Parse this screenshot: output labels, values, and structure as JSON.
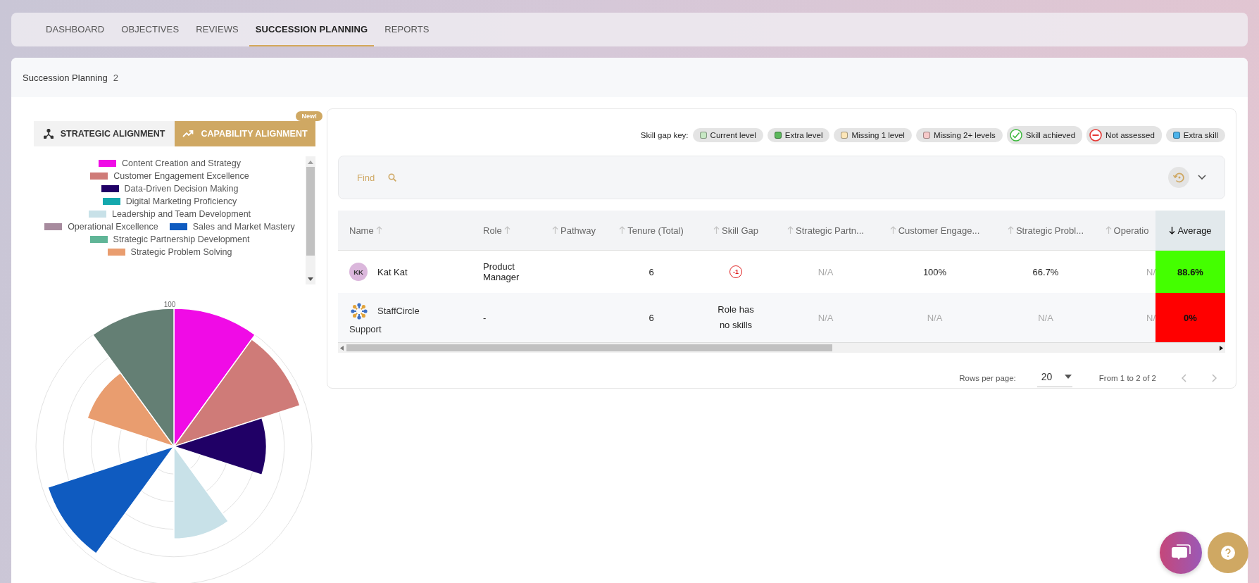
{
  "nav": {
    "tabs": [
      {
        "label": "DASHBOARD",
        "selected": false
      },
      {
        "label": "OBJECTIVES",
        "selected": false
      },
      {
        "label": "REVIEWS",
        "selected": false
      },
      {
        "label": "SUCCESSION PLANNING",
        "selected": true
      },
      {
        "label": "REPORTS",
        "selected": false
      }
    ]
  },
  "header": {
    "title": "Succession Planning",
    "count": "2"
  },
  "alignment": {
    "badge": "New!",
    "tabs": [
      {
        "label": "STRATEGIC ALIGNMENT",
        "selected": false
      },
      {
        "label": "CAPABILITY ALIGNMENT",
        "selected": true
      }
    ]
  },
  "legend": [
    {
      "label": "Content Creation and Strategy",
      "color": "#f00be6"
    },
    {
      "label": "Customer Engagement Excellence",
      "color": "#cf7b78"
    },
    {
      "label": "Data-Driven Decision Making",
      "color": "#200066"
    },
    {
      "label": "Digital Marketing Proficiency",
      "color": "#14a8ad"
    },
    {
      "label": "Leadership and Team Development",
      "color": "#c8e1e8"
    },
    {
      "label": "Operational Excellence",
      "color": "#a78b9e"
    },
    {
      "label": "Sales and Market Mastery",
      "color": "#0f5bc0"
    },
    {
      "label": "Strategic Partnership Development",
      "color": "#60b597"
    },
    {
      "label": "Strategic Problem Solving",
      "color": "#e99d6f"
    }
  ],
  "chart_tick": "100",
  "skill_gap_key": {
    "label": "Skill gap key:",
    "items": [
      {
        "label": "Current level",
        "kind": "swatch",
        "color": "#c7e8c4"
      },
      {
        "label": "Extra level",
        "kind": "swatch",
        "color": "#5cb85c"
      },
      {
        "label": "Missing 1 level",
        "kind": "swatch",
        "color": "#fde6b8"
      },
      {
        "label": "Missing 2+ levels",
        "kind": "swatch",
        "color": "#f6c9c9"
      },
      {
        "label": "Skill achieved",
        "kind": "check"
      },
      {
        "label": "Not assessed",
        "kind": "minus"
      },
      {
        "label": "Extra skill",
        "kind": "swatch",
        "color": "#4db3ea"
      }
    ]
  },
  "search": {
    "placeholder": "Find"
  },
  "table": {
    "columns": [
      {
        "label": "Name",
        "sorted": false
      },
      {
        "label": "Role",
        "sorted": false
      },
      {
        "label": "Pathway",
        "sorted": false
      },
      {
        "label": "Tenure (Total)",
        "sorted": false
      },
      {
        "label": "Skill Gap",
        "sorted": false
      },
      {
        "label": "Strategic Partn...",
        "sorted": false
      },
      {
        "label": "Customer Engage...",
        "sorted": false
      },
      {
        "label": "Strategic Probl...",
        "sorted": false
      },
      {
        "label": "Operatio",
        "sorted": false
      },
      {
        "label": "Average",
        "sorted": true
      }
    ],
    "rows": [
      {
        "name": "Kat Kat",
        "avatar": {
          "kind": "initials",
          "text": "KK"
        },
        "role": "Product Manager",
        "tenure": "6",
        "skill_gap": {
          "kind": "badge",
          "text": "-1"
        },
        "scores": [
          {
            "text": "N/A",
            "muted": true
          },
          {
            "text": "100%",
            "muted": false
          },
          {
            "text": "66.7%",
            "muted": false
          },
          {
            "text": "N/",
            "muted": true
          }
        ],
        "average": {
          "text": "88.6%",
          "color": "#44ff00"
        }
      },
      {
        "name": "StaffCircle Support",
        "avatar": {
          "kind": "logo"
        },
        "role": "-",
        "tenure": "6",
        "skill_gap": {
          "kind": "text",
          "text": "Role has no skills"
        },
        "scores": [
          {
            "text": "N/A",
            "muted": true
          },
          {
            "text": "N/A",
            "muted": true
          },
          {
            "text": "N/A",
            "muted": true
          },
          {
            "text": "N/",
            "muted": true
          }
        ],
        "average": {
          "text": "0%",
          "color": "#ff0000"
        }
      }
    ]
  },
  "pagination": {
    "rows_label": "Rows per page:",
    "rows_value": "20",
    "range": "From 1 to 2 of 2"
  }
}
